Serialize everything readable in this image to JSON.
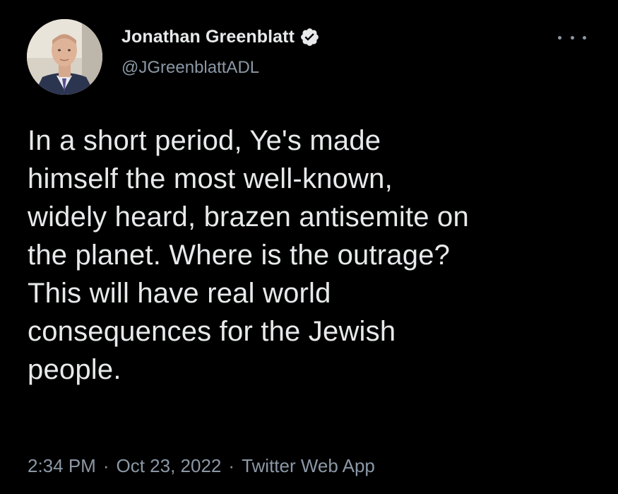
{
  "author": {
    "display_name": "Jonathan Greenblatt",
    "handle": "@JGreenblattADL",
    "verified_icon": "verified-badge-icon",
    "avatar_icon": "avatar"
  },
  "tweet": {
    "text": "In a short period, Ye's made\nhimself the most well-known,\nwidely heard, brazen antisemite on\nthe planet. Where is the outrage?\nThis will have real world\nconsequences for the Jewish\npeople.",
    "time": "2:34 PM",
    "separator": "·",
    "date": "Oct 23, 2022",
    "source": "Twitter Web App"
  },
  "colors": {
    "background": "#000000",
    "text_primary": "#e7e9ea",
    "text_secondary": "#8b98a5"
  },
  "icons": {
    "more": "more-options-icon"
  }
}
